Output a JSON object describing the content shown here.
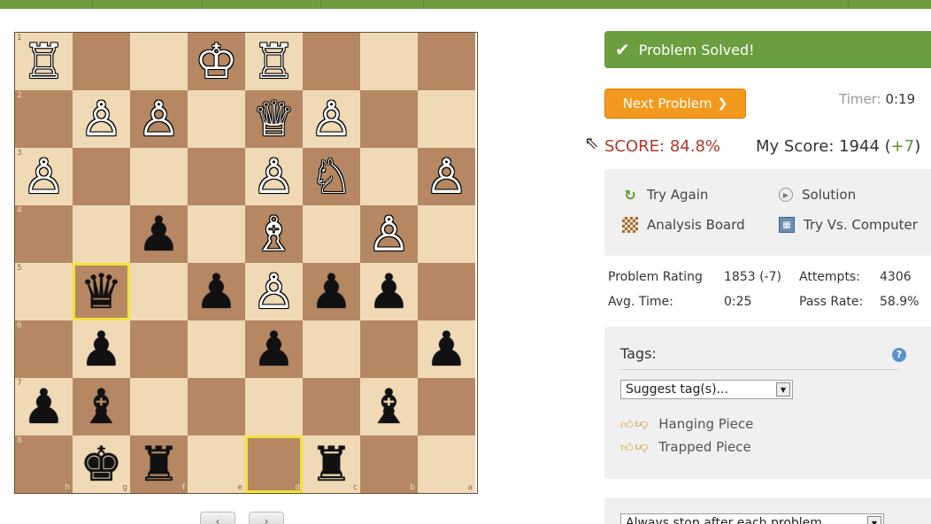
{
  "board": {
    "ranks": [
      "1",
      "2",
      "3",
      "4",
      "5",
      "6",
      "7",
      "8"
    ],
    "files": [
      "h",
      "g",
      "f",
      "e",
      "d",
      "c",
      "b",
      "a"
    ],
    "squares": [
      [
        "wR",
        "",
        "",
        "wK",
        "wR",
        "",
        "",
        ""
      ],
      [
        "",
        "wP",
        "wP",
        "",
        "wQ",
        "wP",
        "",
        ""
      ],
      [
        "wP",
        "",
        "",
        "",
        "wP",
        "wN",
        "",
        "wP"
      ],
      [
        "",
        "",
        "bP",
        "",
        "wB",
        "",
        "wP",
        ""
      ],
      [
        "",
        "bQ",
        "",
        "bP",
        "wP",
        "bP",
        "bP",
        ""
      ],
      [
        "",
        "bP",
        "",
        "",
        "bP",
        "",
        "",
        "bP"
      ],
      [
        "bP",
        "bB",
        "",
        "",
        "",
        "",
        "bB",
        ""
      ],
      [
        "",
        "bK",
        "bR",
        "",
        "",
        "bR",
        "",
        ""
      ]
    ],
    "highlights": [
      [
        4,
        1
      ],
      [
        7,
        4
      ]
    ]
  },
  "piece_glyphs": {
    "wK": "♔",
    "wQ": "♕",
    "wR": "♖",
    "wB": "♗",
    "wN": "♘",
    "wP": "♙",
    "bK": "♚",
    "bQ": "♛",
    "bR": "♜",
    "bB": "♝",
    "bN": "♞",
    "bP": "♟"
  },
  "nav": {
    "prev_label": "‹",
    "next_label": "›"
  },
  "status": {
    "solved_text": "Problem Solved!",
    "icon": "check-icon"
  },
  "next_button": {
    "label": "Next Problem"
  },
  "timer": {
    "label": "Timer:",
    "value": "0:19"
  },
  "score": {
    "text": "SCORE: 84.8%"
  },
  "my_score": {
    "label": "My Score: 1944 (",
    "delta": "+7",
    "close": ")"
  },
  "actions": {
    "try_again": "Try Again",
    "solution": "Solution",
    "analysis_board": "Analysis Board",
    "try_vs_computer": "Try Vs. Computer"
  },
  "stats": {
    "rating_label": "Problem Rating",
    "rating_value": "1853 (-7)",
    "attempts_label": "Attempts:",
    "attempts_value": "4306",
    "avg_time_label": "Avg. Time:",
    "avg_time_value": "0:25",
    "pass_rate_label": "Pass Rate:",
    "pass_rate_value": "58.9%"
  },
  "tags": {
    "title": "Tags:",
    "suggest_placeholder": "Suggest tag(s)...",
    "items": [
      "Hanging Piece",
      "Trapped Piece"
    ]
  },
  "settings": {
    "advance_option": "Always stop after each problem"
  },
  "colors": {
    "accent_green": "#6a9e3f",
    "orange": "#f39a1e",
    "score_red": "#b3372a"
  }
}
